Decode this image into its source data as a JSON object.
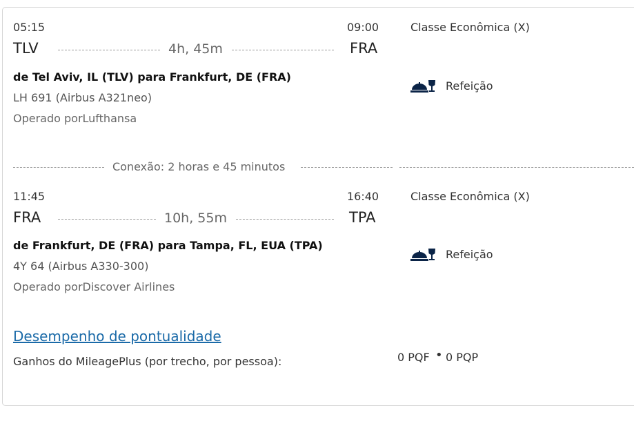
{
  "segments": [
    {
      "depart_time": "05:15",
      "arrive_time": "09:00",
      "from_code": "TLV",
      "to_code": "FRA",
      "duration": "4h, 45m",
      "route": "de Tel Aviv, IL (TLV) para Frankfurt, DE (FRA)",
      "flight": "LH 691 (Airbus A321neo)",
      "operator": "Operado porLufthansa",
      "cabin": "Classe Econômica (X)",
      "meal": "Refeição",
      "meal_icon": "meal-service-icon"
    },
    {
      "depart_time": "11:45",
      "arrive_time": "16:40",
      "from_code": "FRA",
      "to_code": "TPA",
      "duration": "10h, 55m",
      "route": "de Frankfurt, DE (FRA) para Tampa, FL, EUA (TPA)",
      "flight": "4Y 64 (Airbus A330-300)",
      "operator": "Operado porDiscover Airlines",
      "cabin": "Classe Econômica (X)",
      "meal": "Refeição",
      "meal_icon": "meal-service-icon"
    }
  ],
  "connection": "Conexão: 2 horas e 45 minutos",
  "performance_link": "Desempenho de pontualidade",
  "earnings_label": "Ganhos do MileagePlus (por trecho, por pessoa):",
  "earnings_pqf": "0 PQF",
  "earnings_sep": "•",
  "earnings_pqp": "0 PQP",
  "colors": {
    "link": "#1a6aa8",
    "icon": "#0b2447",
    "border": "#d6d6d6"
  }
}
